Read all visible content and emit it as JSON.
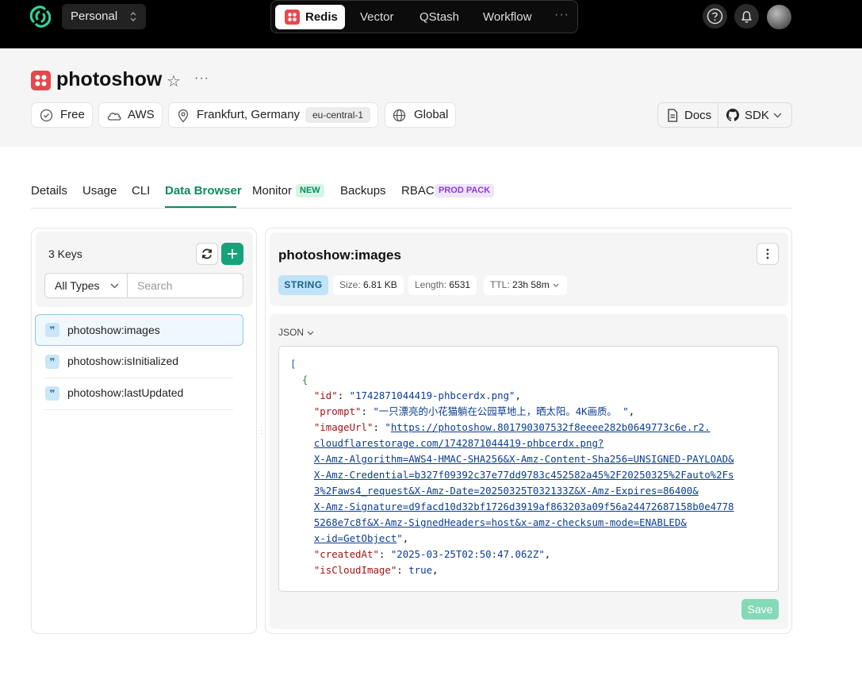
{
  "topnav": {
    "workspace": "Personal",
    "products": [
      "Redis",
      "Vector",
      "QStash",
      "Workflow"
    ],
    "active_product": "Redis",
    "more": "···"
  },
  "database": {
    "name": "photoshow",
    "plan": "Free",
    "provider": "AWS",
    "location": "Frankfurt, Germany",
    "region": "eu-central-1",
    "scope": "Global",
    "docs": "Docs",
    "sdk": "SDK"
  },
  "tabs": [
    {
      "label": "Details"
    },
    {
      "label": "Usage"
    },
    {
      "label": "CLI"
    },
    {
      "label": "Data Browser",
      "active": true
    },
    {
      "label": "Monitor",
      "badge": "NEW"
    },
    {
      "label": "Backups"
    },
    {
      "label": "RBAC",
      "badge": "PROD PACK"
    }
  ],
  "browser": {
    "key_count": "3 Keys",
    "type_filter": "All Types",
    "search_placeholder": "Search",
    "keys": [
      {
        "name": "photoshow:images",
        "selected": true
      },
      {
        "name": "photoshow:isInitialized"
      },
      {
        "name": "photoshow:lastUpdated"
      }
    ]
  },
  "detail": {
    "key": "photoshow:images",
    "type": "STRING",
    "size_label": "Size:",
    "size": "6.81 KB",
    "length_label": "Length:",
    "length": "6531",
    "ttl_label": "TTL:",
    "ttl": "23h 58m",
    "format": "JSON",
    "save": "Save",
    "code": {
      "open_bracket": "[",
      "open_brace": "{",
      "id_key": "\"id\"",
      "id_val": "\"1742871044419-phbcerdx.png\"",
      "prompt_key": "\"prompt\"",
      "prompt_val": "\"一只漂亮的小花猫躺在公园草地上，晒太阳。4K画质。 \"",
      "url_key": "\"imageUrl\"",
      "url_lines": [
        "https://photoshow.801790307532f8eeee282b0649773c6e.r2.",
        "cloudflarestorage.com/1742871044419-phbcerdx.png?",
        "X-Amz-Algorithm=AWS4-HMAC-SHA256&X-Amz-Content-Sha256=UNSIGNED-PAYLOAD&",
        "X-Amz-Credential=b327f09392c37e77dd9783c452582a45%2F20250325%2Fauto%2Fs",
        "3%2Faws4_request&X-Amz-Date=20250325T032133Z&X-Amz-Expires=86400&",
        "X-Amz-Signature=d9facd10d32bf1726d3919af863203a09f56a24472687158b0e4778",
        "5268e7c8f&X-Amz-SignedHeaders=host&x-amz-checksum-mode=ENABLED&",
        "x-id=GetObject"
      ],
      "created_key": "\"createdAt\"",
      "created_val": "\"2025-03-25T02:50:47.062Z\"",
      "cloud_key": "\"isCloudImage\"",
      "cloud_val": "true"
    }
  },
  "colors": {
    "accent": "#0f8a5f",
    "redis": "#e5484d",
    "string_badge": "#bfe3f7",
    "save_disabled": "#84d9b8"
  }
}
